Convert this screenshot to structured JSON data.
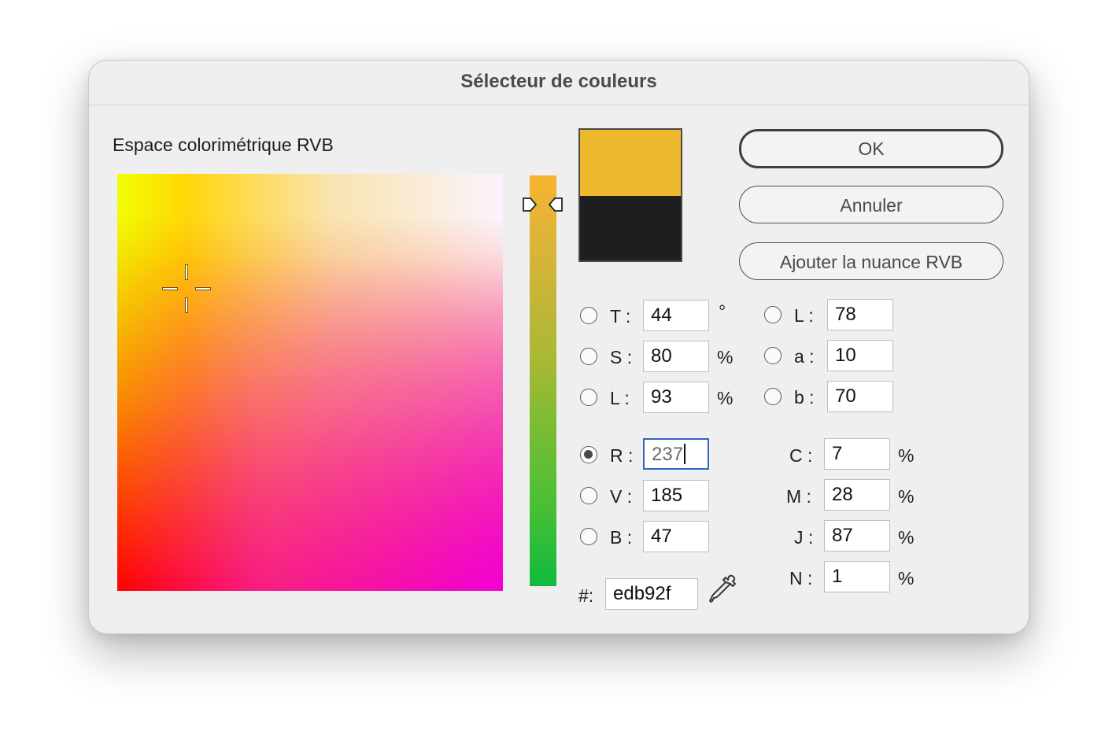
{
  "dialog": {
    "title": "Sélecteur de couleurs",
    "space_label": "Espace colorimétrique RVB"
  },
  "swatch": {
    "new_color": "#edb92f",
    "old_color": "#1e1e1e"
  },
  "buttons": {
    "ok": "OK",
    "cancel": "Annuler",
    "add_swatch": "Ajouter la nuance RVB"
  },
  "hsl": {
    "t": {
      "label": "T :",
      "value": "44",
      "unit": "°"
    },
    "s": {
      "label": "S :",
      "value": "80",
      "unit": "%"
    },
    "l": {
      "label": "L :",
      "value": "93",
      "unit": "%"
    }
  },
  "lab": {
    "l": {
      "label": "L :",
      "value": "78"
    },
    "a": {
      "label": "a :",
      "value": "10"
    },
    "b": {
      "label": "b :",
      "value": "70"
    }
  },
  "rgb": {
    "r": {
      "label": "R :",
      "value": "237",
      "selected": true
    },
    "v": {
      "label": "V :",
      "value": "185"
    },
    "b": {
      "label": "B :",
      "value": "47"
    }
  },
  "cmyk": {
    "c": {
      "label": "C :",
      "value": "7",
      "unit": "%"
    },
    "m": {
      "label": "M :",
      "value": "28",
      "unit": "%"
    },
    "j": {
      "label": "J :",
      "value": "87",
      "unit": "%"
    },
    "n": {
      "label": "N :",
      "value": "1",
      "unit": "%"
    }
  },
  "hex": {
    "label": "#:",
    "value": "edb92f"
  },
  "icons": {
    "eyedropper": "eyedropper-icon",
    "crosshair": "crosshair-icon"
  }
}
